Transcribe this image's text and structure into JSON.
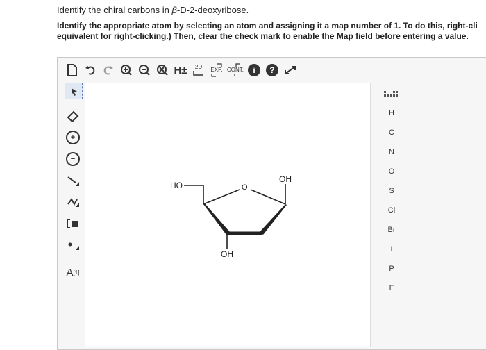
{
  "question": {
    "line1_prefix": "Identify the chiral carbons in ",
    "line1_beta": "β",
    "line1_suffix": "-D-2-deoxyribose.",
    "line2": "Identify the appropriate atom by selecting an atom and assigning it a map number of 1. To do this, right-cli",
    "line3": "equivalent for right-clicking.) Then, clear the check mark to enable the Map field before entering a value."
  },
  "toolbar": {
    "h_label": "H±",
    "twod_label": "2D",
    "exp_label": "EXP.",
    "cont_label": "CONT.",
    "info_label": "i",
    "help_label": "?"
  },
  "left_tools": {
    "plus_label": "+",
    "minus_label": "−",
    "chain_label": "N",
    "atom_map_label": "A",
    "atom_map_sup": "[1]"
  },
  "elements": [
    "H",
    "C",
    "N",
    "O",
    "S",
    "Cl",
    "Br",
    "I",
    "P",
    "F"
  ],
  "molecule": {
    "ho_label": "HO",
    "ring_o_label": "O",
    "oh_right_label": "OH",
    "oh_bottom_label": "OH"
  }
}
